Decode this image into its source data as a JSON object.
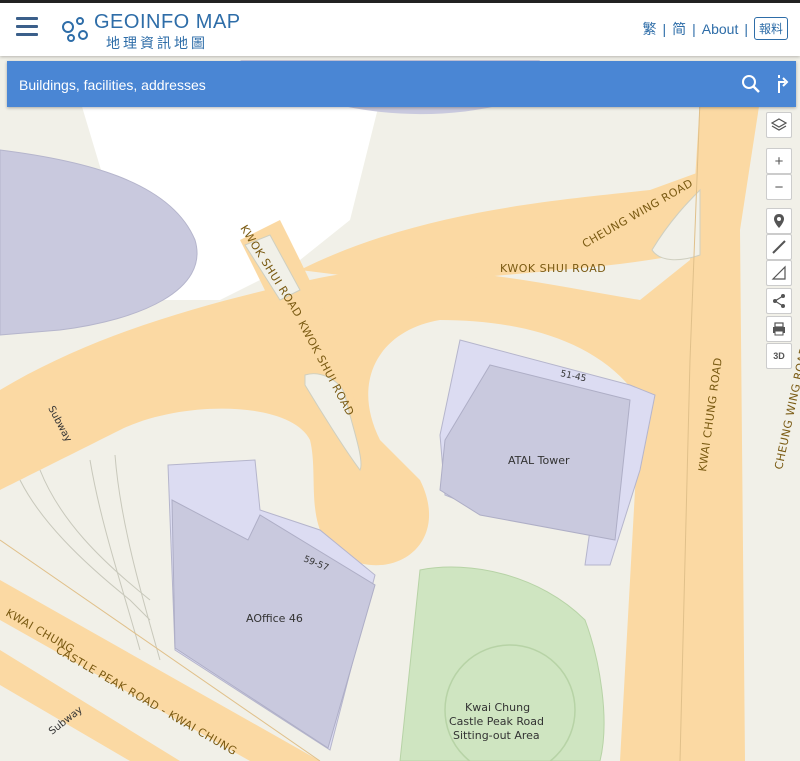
{
  "header": {
    "logo_en": "GEOINFO MAP",
    "logo_zh": "地理資訊地圖",
    "lang_trad": "繁",
    "lang_simp": "简",
    "about": "About",
    "report": "報料"
  },
  "search": {
    "placeholder": "Buildings, facilities, addresses"
  },
  "map_tools": {
    "zoom_in": "+",
    "zoom_out": "−",
    "three_d": "3D"
  },
  "map": {
    "roads": {
      "kwok_shui_road_1": "KWOK SHUI ROAD",
      "kwok_shui_road_2": "KWOK SHUI ROAD",
      "kwok_shui_road_3": "KWOK SHUI ROAD",
      "cheung_wing_road_1": "CHEUNG WING ROAD",
      "cheung_wing_road_2": "CHEUNG WING ROAD",
      "kwai_chung_road": "KWAI CHUNG ROAD",
      "castle_peak_road_1": "CASTLE PEAK ROAD - KWAI CHUNG",
      "castle_peak_road_2": "KWAI CHUNG",
      "subway_1": "Subway",
      "subway_2": "Subway"
    },
    "buildings": {
      "atal_tower": "ATAL Tower",
      "atal_number": "51-45",
      "aoffice": "AOffice 46",
      "aoffice_number": "59-57"
    },
    "parks": {
      "park_line1": "Kwai Chung",
      "park_line2": "Castle Peak Road",
      "park_line3": "Sitting-out Area"
    },
    "colors": {
      "road": "#fbd9a3",
      "building": "#c9c9de",
      "building_light": "#dcdcf2",
      "park": "#cfe5c1",
      "ground": "#f1f0e8",
      "road_label": "#7a5a12",
      "accent": "#4a86d4"
    }
  }
}
